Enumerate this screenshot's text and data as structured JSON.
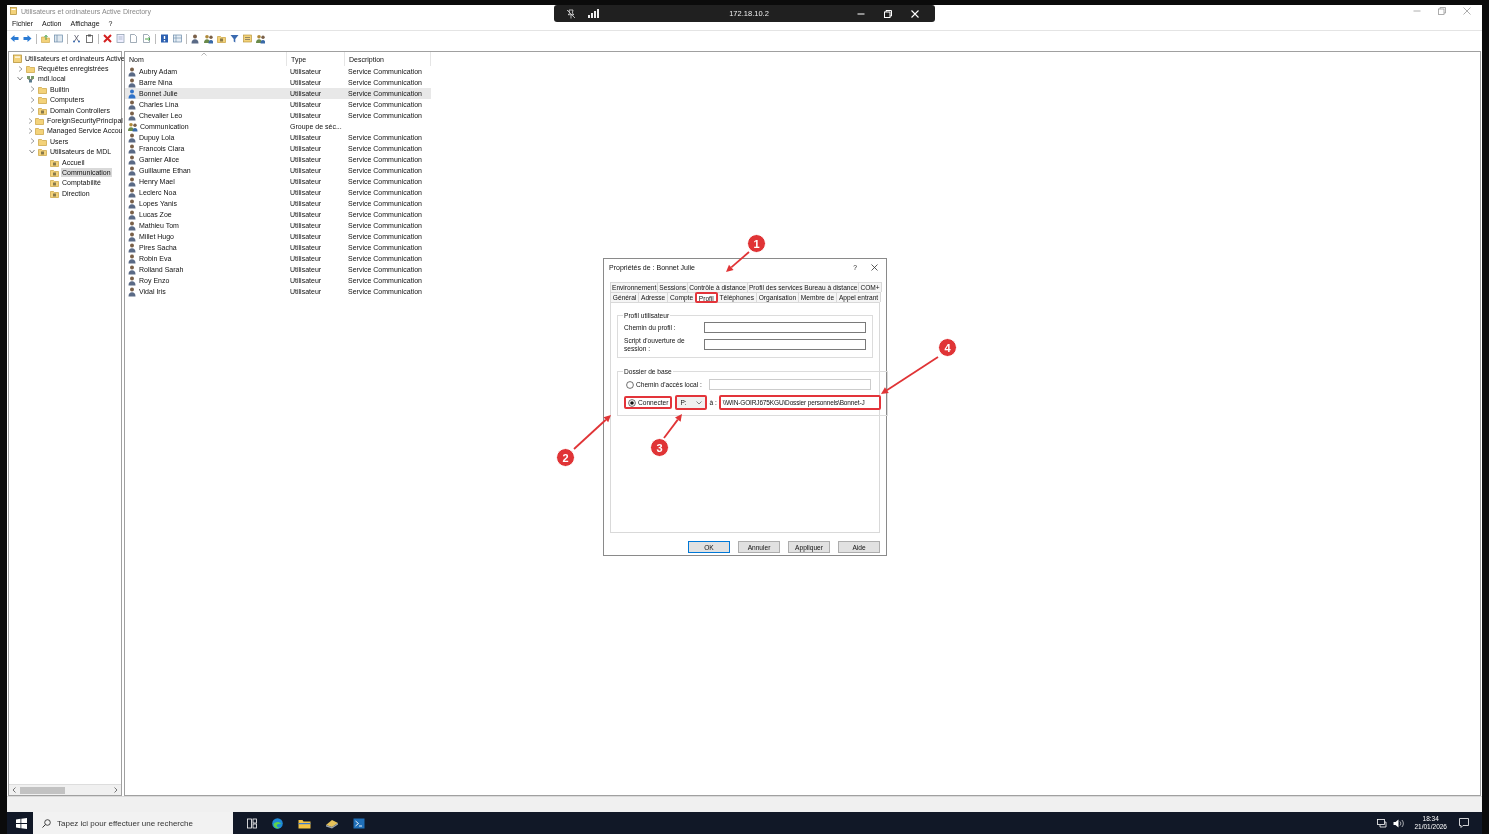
{
  "window": {
    "title": "Utilisateurs et ordinateurs Active Directory"
  },
  "menu": [
    {
      "label": "Fichier"
    },
    {
      "label": "Action"
    },
    {
      "label": "Affichage"
    },
    {
      "label": "?"
    }
  ],
  "remote_bar": {
    "address": "172.18.10.2"
  },
  "tree": {
    "label": "Utilisateurs et ordinateurs Active",
    "kind": "console",
    "selected": false,
    "children": [
      {
        "label": "Requêtes enregistrées",
        "kind": "folder",
        "expanded": false,
        "selected": false
      },
      {
        "label": "mdl.local",
        "kind": "domain",
        "expanded": true,
        "selected": false,
        "children": [
          {
            "label": "Builtin",
            "kind": "folder",
            "expanded": false,
            "selected": false
          },
          {
            "label": "Computers",
            "kind": "folder",
            "expanded": false,
            "selected": false
          },
          {
            "label": "Domain Controllers",
            "kind": "ou",
            "expanded": false,
            "selected": false
          },
          {
            "label": "ForeignSecurityPrincipal",
            "kind": "folder",
            "expanded": false,
            "selected": false
          },
          {
            "label": "Managed Service Accou",
            "kind": "folder",
            "expanded": false,
            "selected": false
          },
          {
            "label": "Users",
            "kind": "folder",
            "expanded": false,
            "selected": false
          },
          {
            "label": "Utilisateurs de MDL",
            "kind": "ou",
            "expanded": true,
            "selected": false,
            "children": [
              {
                "label": "Accueil",
                "kind": "ou",
                "selected": false
              },
              {
                "label": "Communication",
                "kind": "ou",
                "selected": true
              },
              {
                "label": "Comptabilité",
                "kind": "ou",
                "selected": false
              },
              {
                "label": "Direction",
                "kind": "ou",
                "selected": false
              }
            ]
          }
        ]
      }
    ]
  },
  "list": {
    "columns": [
      {
        "label": "Nom",
        "sorted": true
      },
      {
        "label": "Type",
        "sorted": false
      },
      {
        "label": "Description",
        "sorted": false
      }
    ],
    "rows": [
      {
        "name": "Aubry Adam",
        "type": "Utilisateur",
        "description": "Service Communication",
        "kind": "user",
        "selected": false
      },
      {
        "name": "Barre Nina",
        "type": "Utilisateur",
        "description": "Service Communication",
        "kind": "user",
        "selected": false
      },
      {
        "name": "Bonnet Julie",
        "type": "Utilisateur",
        "description": "Service Communication",
        "kind": "user",
        "selected": true
      },
      {
        "name": "Charles Lina",
        "type": "Utilisateur",
        "description": "Service Communication",
        "kind": "user",
        "selected": false
      },
      {
        "name": "Chevalier Leo",
        "type": "Utilisateur",
        "description": "Service Communication",
        "kind": "user",
        "selected": false
      },
      {
        "name": "Communication",
        "type": "Groupe de séc...",
        "kind": "group",
        "selected": false
      },
      {
        "name": "Dupuy Lola",
        "type": "Utilisateur",
        "description": "Service Communication",
        "kind": "user",
        "selected": false
      },
      {
        "name": "Francois Clara",
        "type": "Utilisateur",
        "description": "Service Communication",
        "kind": "user",
        "selected": false
      },
      {
        "name": "Garnier Alice",
        "type": "Utilisateur",
        "description": "Service Communication",
        "kind": "user",
        "selected": false
      },
      {
        "name": "Guillaume Ethan",
        "type": "Utilisateur",
        "description": "Service Communication",
        "kind": "user",
        "selected": false
      },
      {
        "name": "Henry Mael",
        "type": "Utilisateur",
        "description": "Service Communication",
        "kind": "user",
        "selected": false
      },
      {
        "name": "Leclerc Noa",
        "type": "Utilisateur",
        "description": "Service Communication",
        "kind": "user",
        "selected": false
      },
      {
        "name": "Lopes Yanis",
        "type": "Utilisateur",
        "description": "Service Communication",
        "kind": "user",
        "selected": false
      },
      {
        "name": "Lucas Zoe",
        "type": "Utilisateur",
        "description": "Service Communication",
        "kind": "user",
        "selected": false
      },
      {
        "name": "Mathieu Tom",
        "type": "Utilisateur",
        "description": "Service Communication",
        "kind": "user",
        "selected": false
      },
      {
        "name": "Millet Hugo",
        "type": "Utilisateur",
        "description": "Service Communication",
        "kind": "user",
        "selected": false
      },
      {
        "name": "Pires Sacha",
        "type": "Utilisateur",
        "description": "Service Communication",
        "kind": "user",
        "selected": false
      },
      {
        "name": "Robin Eva",
        "type": "Utilisateur",
        "description": "Service Communication",
        "kind": "user",
        "selected": false
      },
      {
        "name": "Rolland Sarah",
        "type": "Utilisateur",
        "description": "Service Communication",
        "kind": "user",
        "selected": false
      },
      {
        "name": "Roy Enzo",
        "type": "Utilisateur",
        "description": "Service Communication",
        "kind": "user",
        "selected": false
      },
      {
        "name": "Vidal Iris",
        "type": "Utilisateur",
        "description": "Service Communication",
        "kind": "user",
        "selected": false
      }
    ]
  },
  "dialog": {
    "title": "Propriétés de : Bonnet Julie",
    "help_label": "?",
    "tabs_back": [
      {
        "label": "Environnement",
        "selected": false,
        "highlighted": false
      },
      {
        "label": "Sessions",
        "selected": false,
        "highlighted": false
      },
      {
        "label": "Contrôle à distance",
        "selected": false,
        "highlighted": false
      },
      {
        "label": "Profil des services Bureau à distance",
        "selected": false,
        "highlighted": false
      },
      {
        "label": "COM+",
        "selected": false,
        "highlighted": false
      }
    ],
    "tabs_front": [
      {
        "label": "Général",
        "selected": false,
        "highlighted": false
      },
      {
        "label": "Adresse",
        "selected": false,
        "highlighted": false
      },
      {
        "label": "Compte",
        "selected": false,
        "highlighted": false
      },
      {
        "label": "Profil",
        "selected": true,
        "highlighted": true
      },
      {
        "label": "Téléphones",
        "selected": false,
        "highlighted": false
      },
      {
        "label": "Organisation",
        "selected": false,
        "highlighted": false
      },
      {
        "label": "Membre de",
        "selected": false,
        "highlighted": false
      },
      {
        "label": "Appel entrant",
        "selected": false,
        "highlighted": false
      }
    ],
    "profile_group": {
      "title": "Profil utilisateur",
      "fields": [
        {
          "label": "Chemin du profil :"
        },
        {
          "label": "Script d'ouverture de session :"
        }
      ]
    },
    "home_group": {
      "title": "Dossier de base",
      "options": [
        {
          "kind": "local",
          "label": "Chemin d'accès local :",
          "selected": false,
          "highlighted": false
        },
        {
          "kind": "connect",
          "label": "Connecter",
          "selected": true,
          "highlighted": true,
          "drive": {
            "value": "P:",
            "highlighted": true
          },
          "to_label": "à :",
          "path": {
            "value": "\\\\WIN-GOIRJ675KGU\\Dossier personnels\\Bonnet-J",
            "highlighted": true
          }
        }
      ]
    },
    "buttons": [
      {
        "label": "OK",
        "default": true
      },
      {
        "label": "Annuler",
        "default": false
      },
      {
        "label": "Appliquer",
        "default": false
      },
      {
        "label": "Aide",
        "default": false
      }
    ]
  },
  "annotations": [
    {
      "number": "1"
    },
    {
      "number": "2"
    },
    {
      "number": "3"
    },
    {
      "number": "4"
    }
  ],
  "taskbar": {
    "search_placeholder": "Tapez ici pour effectuer une recherche",
    "time": "18:34",
    "date": "21/01/2026"
  }
}
